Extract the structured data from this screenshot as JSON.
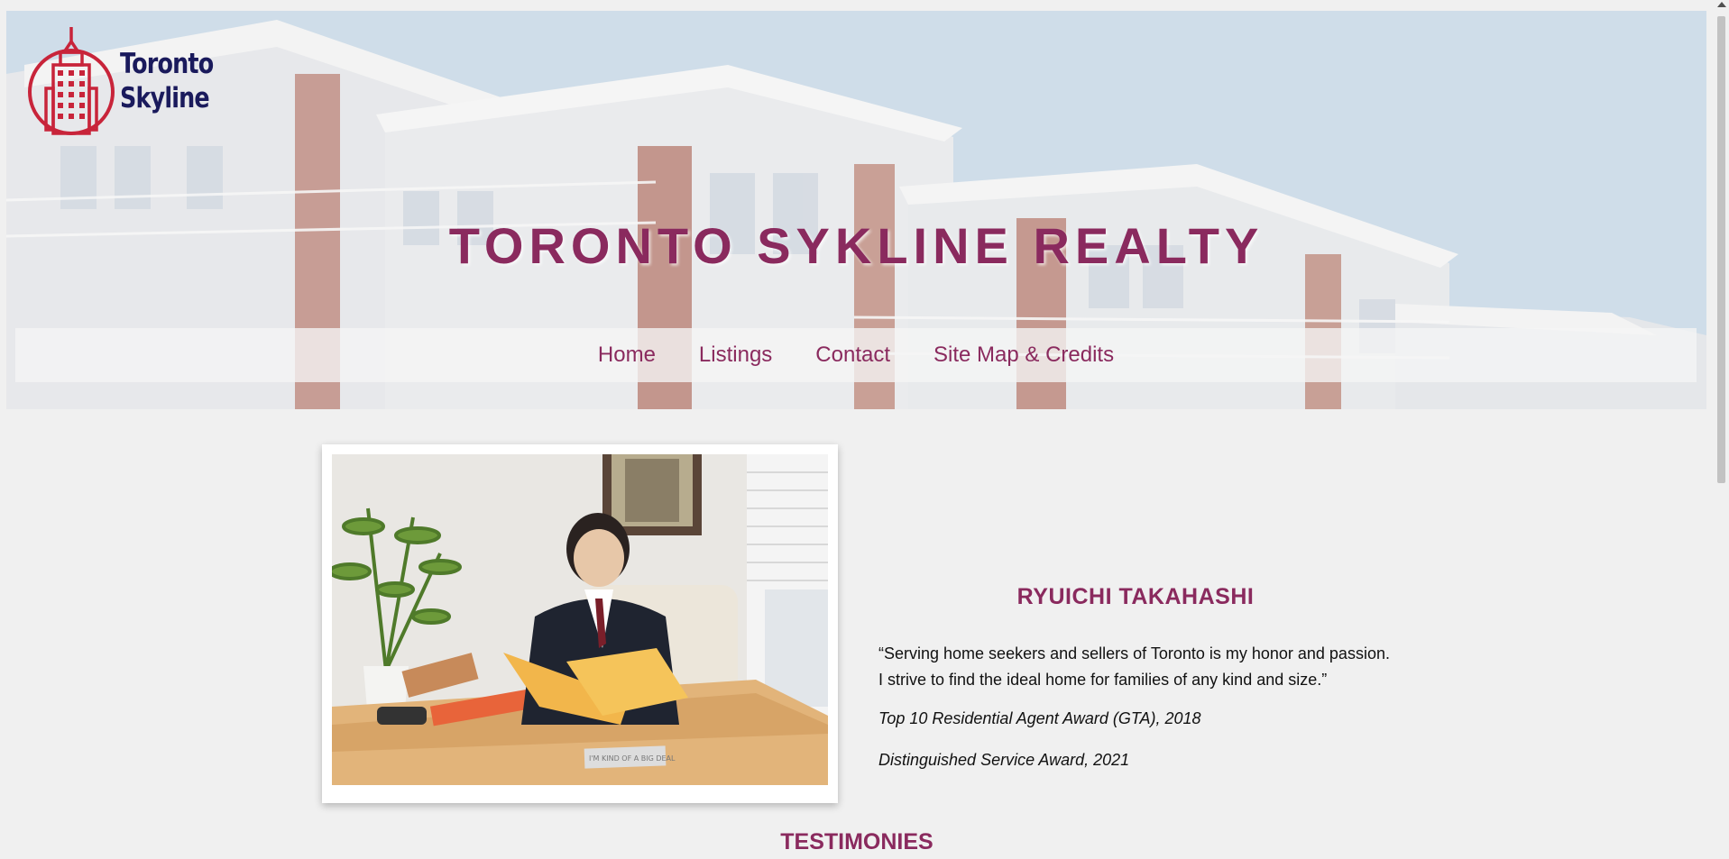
{
  "brand": {
    "logo_line1": "Toronto",
    "logo_line2": "Skyline",
    "logo_color": "#c8243a",
    "text_color": "#1a1a5c"
  },
  "header": {
    "title": "TORONTO SYKLINE REALTY",
    "title_color": "#8a2a5e"
  },
  "nav": {
    "items": [
      {
        "label": "Home"
      },
      {
        "label": "Listings"
      },
      {
        "label": "Contact"
      },
      {
        "label": "Site Map & Credits"
      }
    ]
  },
  "agent": {
    "name": "RYUICHI TAKAHASHI",
    "quote_line1": "“Serving home seekers and sellers of Toronto is my honor and passion.",
    "quote_line2": "I strive to find the ideal home for families of any kind and size.”",
    "award1": "Top 10 Residential Agent Award (GTA), 2018",
    "award2": "Distinguished Service Award, 2021",
    "desk_sign": "I'M KIND OF A BIG DEAL"
  },
  "sections": {
    "testimonies": "TESTIMONIES"
  },
  "icons": {
    "logo": "skyscraper-icon"
  }
}
